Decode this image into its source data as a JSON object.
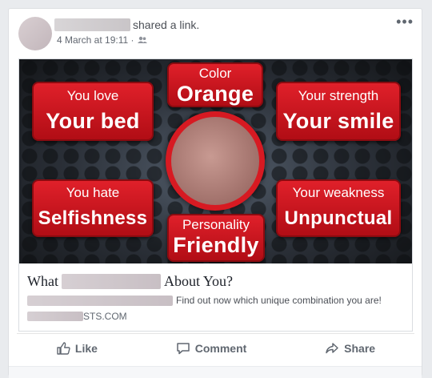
{
  "post": {
    "shared_text": "shared a link.",
    "timestamp": "4 March at 19:11 ·",
    "more_label": "•••"
  },
  "image": {
    "top_label": "Color",
    "top_value": "Orange",
    "love_label": "You love",
    "love_value": "Your bed",
    "strength_label": "Your strength",
    "strength_value": "Your smile",
    "hate_label": "You hate",
    "hate_value": "Selfishness",
    "weakness_label": "Your weakness",
    "weakness_value": "Unpunctual",
    "personality_label": "Personality",
    "personality_value": "Friendly"
  },
  "link": {
    "title_prefix": "What",
    "title_suffix": "About You?",
    "description": "Find out now which unique combination you are!",
    "domain_suffix": "STS.COM"
  },
  "actions": {
    "like": "Like",
    "comment": "Comment",
    "share": "Share"
  },
  "colors": {
    "accent_red": "#d71a22",
    "action_gray": "#606770"
  }
}
